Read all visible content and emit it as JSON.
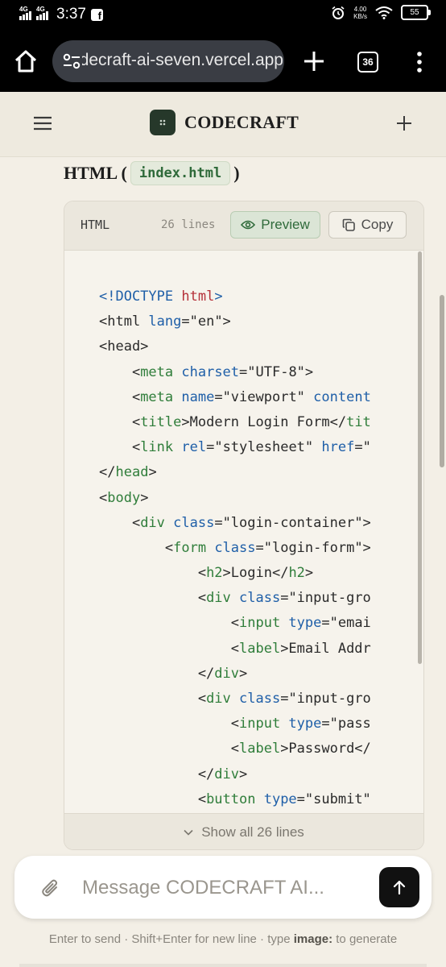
{
  "status_bar": {
    "network_1": "4G",
    "network_2": "4G",
    "time": "3:37",
    "speed_value": "4.00",
    "speed_unit": "KB/s",
    "battery": "55",
    "icons": [
      "facebook-icon",
      "alarm-icon",
      "wifi-icon",
      "battery-icon"
    ]
  },
  "browser": {
    "url": "codecraft-ai-seven.vercel.app",
    "tab_count": "36",
    "icons": [
      "home-icon",
      "site-settings-icon",
      "new-tab-icon",
      "tabs-icon",
      "more-menu-icon"
    ]
  },
  "app": {
    "name": "CODECRAFT",
    "icons": [
      "hamburger-menu-icon",
      "logo-icon",
      "plus-icon"
    ]
  },
  "section": {
    "prefix": "HTML (",
    "filename": "index.html",
    "suffix": ")"
  },
  "code_block": {
    "language": "HTML",
    "line_count": "26 lines",
    "preview_label": "Preview",
    "copy_label": "Copy",
    "show_all_label": "Show all 26 lines",
    "lines": [
      [
        {
          "t": "<!DOCTYPE ",
          "c": "doc"
        },
        {
          "t": "html",
          "c": "kw"
        },
        {
          "t": ">",
          "c": "doc"
        }
      ],
      [
        {
          "t": "<html ",
          "c": ""
        },
        {
          "t": "lang",
          "c": "attr"
        },
        {
          "t": "=\"en\">",
          "c": ""
        }
      ],
      [
        {
          "t": "<head>",
          "c": ""
        }
      ],
      [
        {
          "t": "    <",
          "c": ""
        },
        {
          "t": "meta ",
          "c": "tag"
        },
        {
          "t": "charset",
          "c": "attr"
        },
        {
          "t": "=\"UTF-8\">",
          "c": ""
        }
      ],
      [
        {
          "t": "    <",
          "c": ""
        },
        {
          "t": "meta ",
          "c": "tag"
        },
        {
          "t": "name",
          "c": "attr"
        },
        {
          "t": "=\"viewport\" ",
          "c": ""
        },
        {
          "t": "content",
          "c": "attr"
        }
      ],
      [
        {
          "t": "    <",
          "c": ""
        },
        {
          "t": "title",
          "c": "tag"
        },
        {
          "t": ">Modern Login Form</",
          "c": ""
        },
        {
          "t": "tit",
          "c": "tag"
        }
      ],
      [
        {
          "t": "    <",
          "c": ""
        },
        {
          "t": "link ",
          "c": "tag"
        },
        {
          "t": "rel",
          "c": "attr"
        },
        {
          "t": "=\"stylesheet\" ",
          "c": ""
        },
        {
          "t": "href",
          "c": "attr"
        },
        {
          "t": "=\"",
          "c": ""
        }
      ],
      [
        {
          "t": "</",
          "c": ""
        },
        {
          "t": "head",
          "c": "tag"
        },
        {
          "t": ">",
          "c": ""
        }
      ],
      [
        {
          "t": "<",
          "c": ""
        },
        {
          "t": "body",
          "c": "tag"
        },
        {
          "t": ">",
          "c": ""
        }
      ],
      [
        {
          "t": "    <",
          "c": ""
        },
        {
          "t": "div ",
          "c": "tag"
        },
        {
          "t": "class",
          "c": "attr"
        },
        {
          "t": "=\"login-container\">",
          "c": ""
        }
      ],
      [
        {
          "t": "        <",
          "c": ""
        },
        {
          "t": "form ",
          "c": "tag"
        },
        {
          "t": "class",
          "c": "attr"
        },
        {
          "t": "=\"login-form\">",
          "c": ""
        }
      ],
      [
        {
          "t": "            <",
          "c": ""
        },
        {
          "t": "h2",
          "c": "tag"
        },
        {
          "t": ">Login</",
          "c": ""
        },
        {
          "t": "h2",
          "c": "tag"
        },
        {
          "t": ">",
          "c": ""
        }
      ],
      [
        {
          "t": "            <",
          "c": ""
        },
        {
          "t": "div ",
          "c": "tag"
        },
        {
          "t": "class",
          "c": "attr"
        },
        {
          "t": "=\"input-gro",
          "c": ""
        }
      ],
      [
        {
          "t": "                <",
          "c": ""
        },
        {
          "t": "input ",
          "c": "tag"
        },
        {
          "t": "type",
          "c": "attr"
        },
        {
          "t": "=\"emai",
          "c": ""
        }
      ],
      [
        {
          "t": "                <",
          "c": ""
        },
        {
          "t": "label",
          "c": "tag"
        },
        {
          "t": ">Email Addr",
          "c": ""
        }
      ],
      [
        {
          "t": "            </",
          "c": ""
        },
        {
          "t": "div",
          "c": "tag"
        },
        {
          "t": ">",
          "c": ""
        }
      ],
      [
        {
          "t": "            <",
          "c": ""
        },
        {
          "t": "div ",
          "c": "tag"
        },
        {
          "t": "class",
          "c": "attr"
        },
        {
          "t": "=\"input-gro",
          "c": ""
        }
      ],
      [
        {
          "t": "                <",
          "c": ""
        },
        {
          "t": "input ",
          "c": "tag"
        },
        {
          "t": "type",
          "c": "attr"
        },
        {
          "t": "=\"pass",
          "c": ""
        }
      ],
      [
        {
          "t": "                <",
          "c": ""
        },
        {
          "t": "label",
          "c": "tag"
        },
        {
          "t": ">Password</",
          "c": ""
        }
      ],
      [
        {
          "t": "            </",
          "c": ""
        },
        {
          "t": "div",
          "c": "tag"
        },
        {
          "t": ">",
          "c": ""
        }
      ],
      [
        {
          "t": "            <",
          "c": ""
        },
        {
          "t": "button ",
          "c": "tag"
        },
        {
          "t": "type",
          "c": "attr"
        },
        {
          "t": "=\"submit\"",
          "c": ""
        }
      ]
    ]
  },
  "composer": {
    "placeholder": "Message CODECRAFT AI...",
    "hint_part1": "Enter to send · Shift+Enter for new line · type ",
    "hint_keyword": "image:",
    "hint_part2": " to generate",
    "icons": [
      "attach-icon",
      "send-arrow-icon"
    ]
  },
  "colors": {
    "background": "#f3efe6",
    "accent_green": "#2f6a3a",
    "logo_green": "#26382a",
    "code_red": "#b5313a",
    "code_blue": "#1f5fa8",
    "code_tag_green": "#2f7d3a"
  }
}
